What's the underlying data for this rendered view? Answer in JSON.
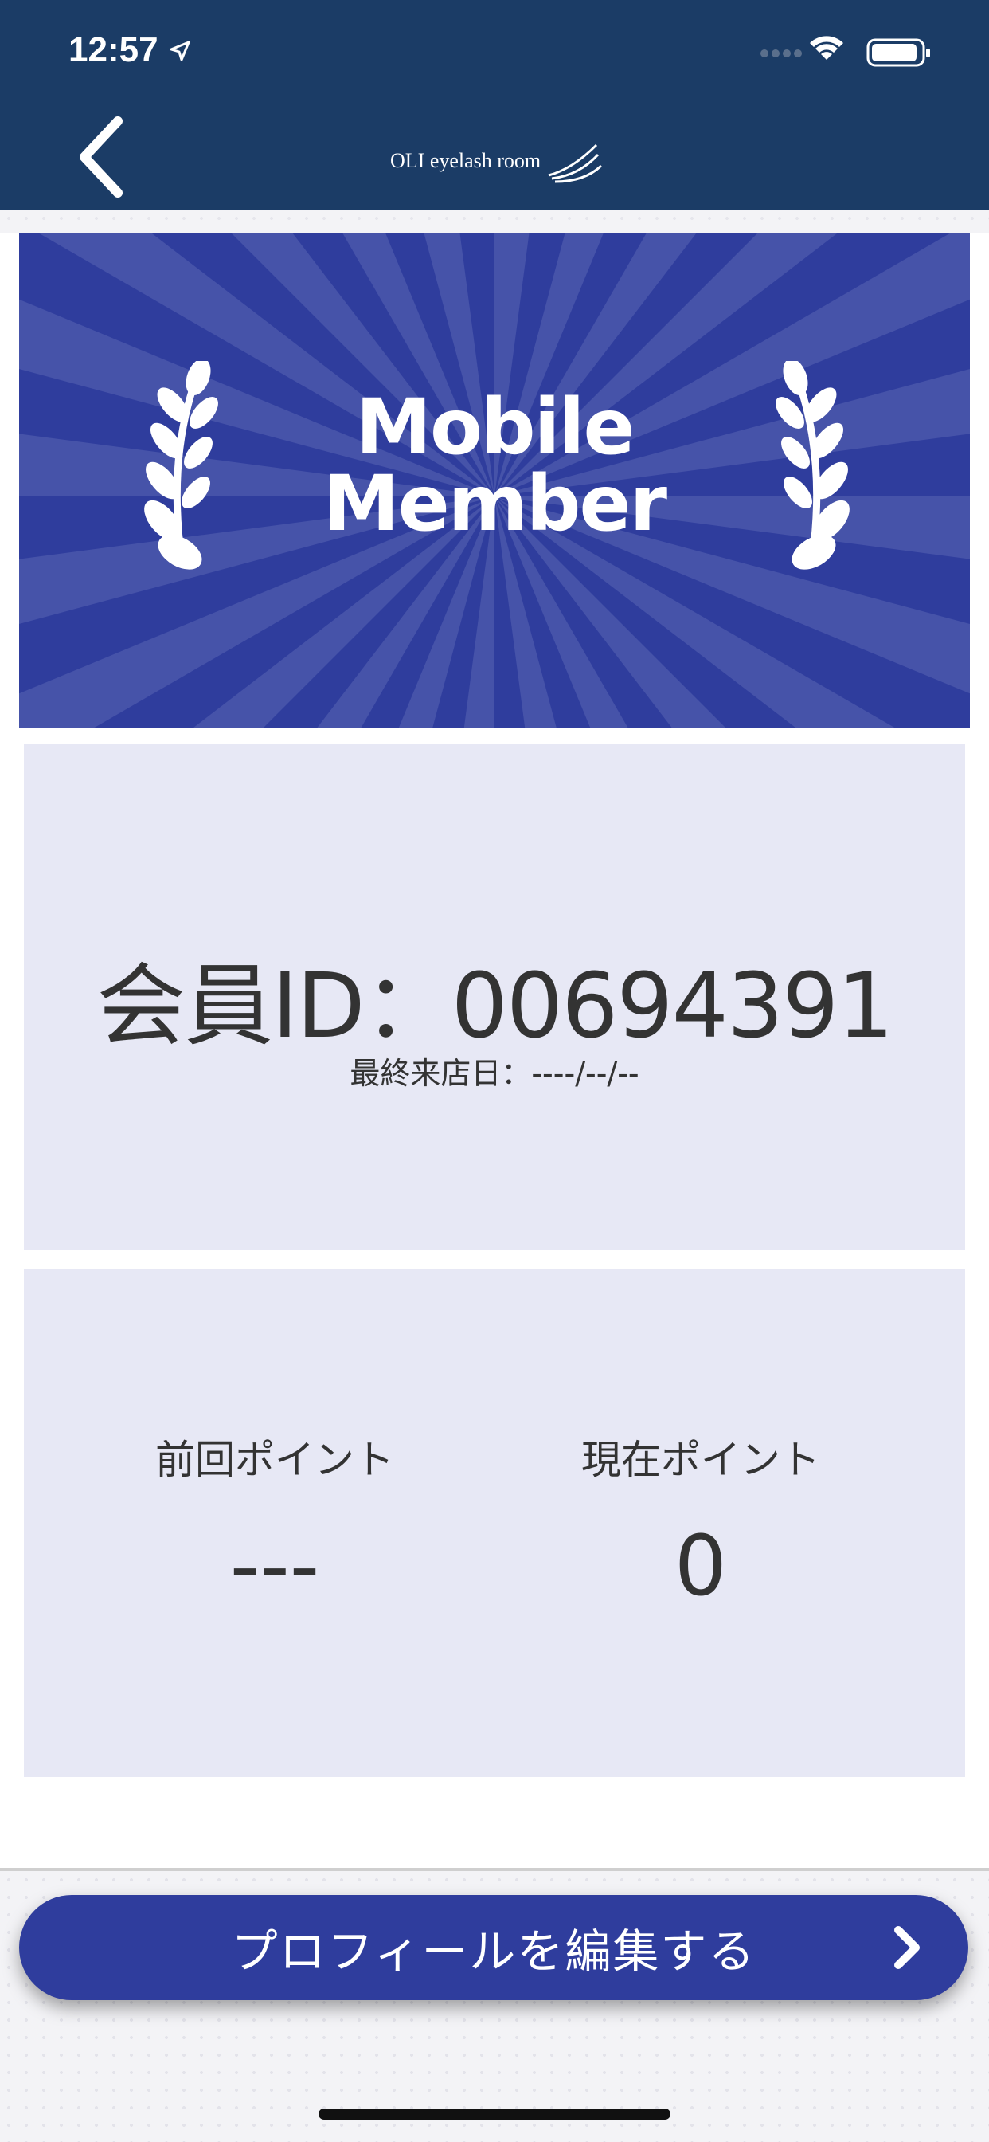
{
  "status_bar": {
    "time": "12:57",
    "icons": [
      "location-arrow-icon",
      "signal-icon",
      "wifi-icon",
      "battery-icon"
    ]
  },
  "header": {
    "logo_text": "OLI eyelash room",
    "back_icon": "chevron-left-icon"
  },
  "banner": {
    "title_line1": "Mobile",
    "title_line2": "Member",
    "colors": {
      "background": "#2f3d9d",
      "rays": "#4653a9"
    }
  },
  "member": {
    "id_label": "会員ID：",
    "id_value": "00694391",
    "last_visit_label": "最終来店日：",
    "last_visit_value": "----/--/--"
  },
  "points": {
    "previous_label": "前回ポイント",
    "previous_value": "---",
    "current_label": "現在ポイント",
    "current_value": "0"
  },
  "edit_profile": {
    "label": "プロフィールを編集する",
    "icon": "chevron-right-icon"
  },
  "colors": {
    "header": "#1b3c66",
    "accent": "#2f3d9d",
    "card": "#e7e8f5"
  }
}
